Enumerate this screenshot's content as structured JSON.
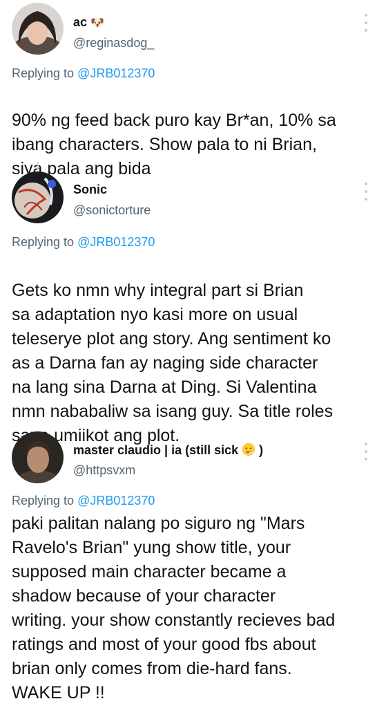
{
  "tweets": [
    {
      "name": "ac",
      "name_emoji": "🐶",
      "handle": "@reginasdog_",
      "replying_prefix": "Replying to ",
      "replying_to": "@JRB012370",
      "text": "90% ng feed back puro kay Br*an, 10% sa\nibang characters. Show pala to ni Brian,\nsiya pala ang bida",
      "trailing_emoji": "😌"
    },
    {
      "name": "Sonic",
      "handle": "@sonictorture",
      "replying_prefix": "Replying to ",
      "replying_to": "@JRB012370",
      "text": "Gets ko nmn why integral part si Brian\nsa adaptation nyo kasi more on usual\nteleserye plot ang story. Ang sentiment ko\nas a Darna fan ay naging side character\nna lang sina Darna at Ding. Si Valentina\nnmn nababaliw sa isang guy. Sa title roles\nsana umiikot ang plot.",
      "trailing_emoji": "😌"
    },
    {
      "name": "master claudio | ia (still sick",
      "name_emoji": "🤒",
      "name_suffix": ")",
      "handle": "@httpsvxm",
      "replying_prefix": "Replying to ",
      "replying_to": "@JRB012370",
      "text": "paki palitan nalang po siguro ng \"Mars\nRavelo's Brian\" yung show title, your\nsupposed main character became a\nshadow because of your character\nwriting. your show constantly recieves bad\nratings and most of your good fbs about\nbrian only comes from die-hard fans.\nWAKE UP !!"
    }
  ],
  "colors": {
    "text": "#0f1419",
    "secondary": "#536471",
    "link": "#1d9bf0",
    "thread_line": "#cfd9de"
  },
  "icons": [
    "more-vertical-icon",
    "relieved-face-emoji",
    "face-with-thermometer-emoji",
    "dog-face-emoji"
  ]
}
